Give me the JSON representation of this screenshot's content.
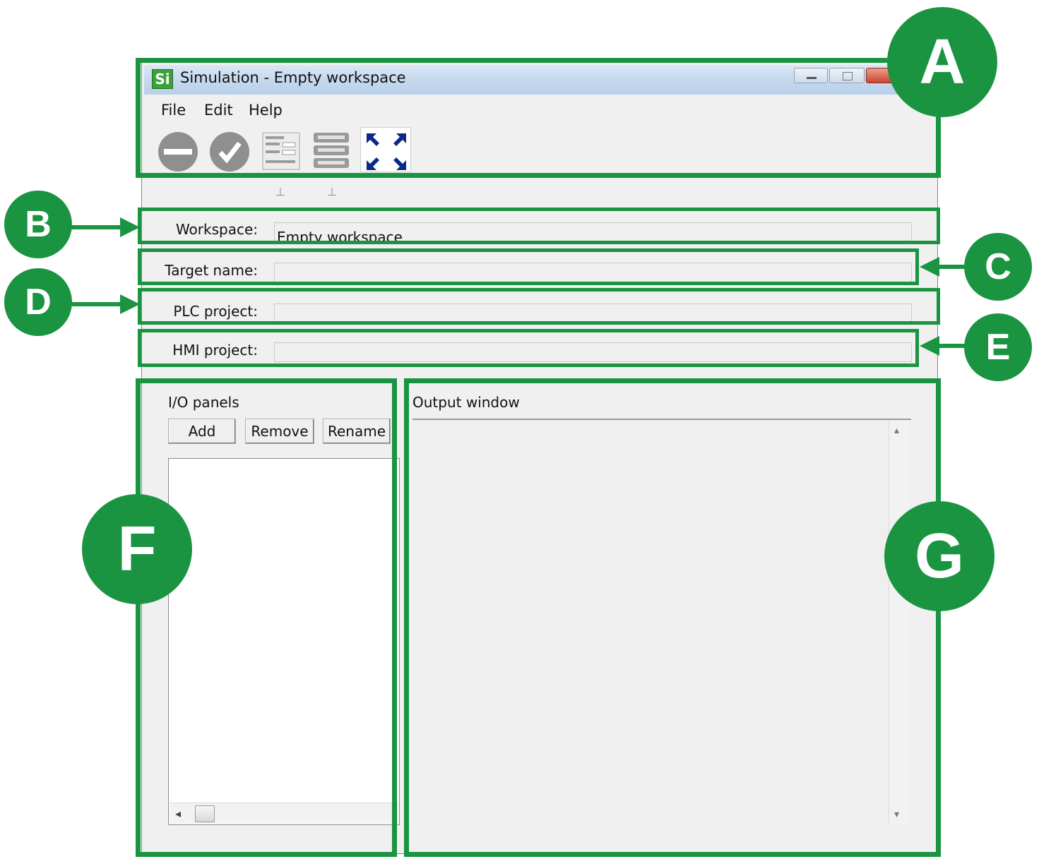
{
  "window": {
    "app_icon": "Si",
    "title": "Simulation - Empty workspace"
  },
  "menu": {
    "items": [
      "File",
      "Edit",
      "Help"
    ]
  },
  "toolbar": {
    "icons": [
      "stop-icon",
      "check-icon",
      "form-icon",
      "rack-icon",
      "fullscreen-icon"
    ]
  },
  "fields": {
    "workspace": {
      "label": "Workspace:",
      "value": "Empty workspace"
    },
    "target_name": {
      "label": "Target name:",
      "value": ""
    },
    "plc_project": {
      "label": "PLC project:",
      "value": ""
    },
    "hmi_project": {
      "label": "HMI project:",
      "value": ""
    }
  },
  "io_panels": {
    "label": "I/O panels",
    "add_label": "Add",
    "remove_label": "Remove",
    "rename_label": "Rename"
  },
  "output": {
    "label": "Output window"
  },
  "callouts": [
    "A",
    "B",
    "C",
    "D",
    "E",
    "F",
    "G"
  ],
  "colors": {
    "callout_green": "#1a9441",
    "window_bg": "#f0f0f0",
    "fullscreen_icon": "#0a2a8a"
  }
}
